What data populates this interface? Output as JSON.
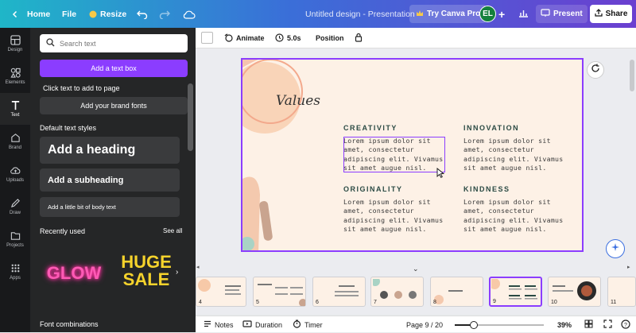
{
  "topbar": {
    "home_label": "Home",
    "file_label": "File",
    "resize_label": "Resize",
    "doc_title": "Untitled design - Presentation",
    "try_label": "Try Canva Pro",
    "avatar_initials": "EL",
    "present_label": "Present",
    "share_label": "Share"
  },
  "rail": {
    "items": [
      {
        "label": "Design"
      },
      {
        "label": "Elements"
      },
      {
        "label": "Text"
      },
      {
        "label": "Brand"
      },
      {
        "label": "Uploads"
      },
      {
        "label": "Draw"
      },
      {
        "label": "Projects"
      },
      {
        "label": "Apps"
      }
    ]
  },
  "panel": {
    "search_placeholder": "Search text",
    "add_text_box": "Add a text box",
    "click_hint": "Click text to add to page",
    "brand_fonts": "Add your brand fonts",
    "default_styles": "Default text styles",
    "heading": "Add a heading",
    "subheading": "Add a subheading",
    "body": "Add a little bit of body text",
    "recently_used": "Recently used",
    "see_all": "See all",
    "recent1": "GLOW",
    "recent2_line1": "HUGE",
    "recent2_line2": "SALE",
    "font_combinations": "Font combinations"
  },
  "toolbar": {
    "animate": "Animate",
    "duration": "5.0s",
    "position": "Position"
  },
  "slide": {
    "title": "Values",
    "sections": [
      {
        "heading": "CREATIVITY",
        "lines": [
          "Lorem ipsum dolor sit",
          "amet, consectetur",
          "adipiscing elit. Vivamus",
          "sit amet augue nisl."
        ]
      },
      {
        "heading": "INNOVATION",
        "lines": [
          "Lorem ipsum dolor sit",
          "amet, consectetur",
          "adipiscing elit. Vivamus",
          "sit amet augue nisl."
        ]
      },
      {
        "heading": "ORIGINALITY",
        "lines": [
          "Lorem ipsum dolor sit",
          "amet, consectetur",
          "adipiscing elit. Vivamus",
          "sit amet augue nisl."
        ]
      },
      {
        "heading": "KINDNESS",
        "lines": [
          "Lorem ipsum dolor sit",
          "amet, consectetur",
          "adipiscing elit. Vivamus",
          "sit amet augue nisl."
        ]
      }
    ]
  },
  "thumbnails": [
    {
      "num": "4"
    },
    {
      "num": "5"
    },
    {
      "num": "6"
    },
    {
      "num": "7"
    },
    {
      "num": "8"
    },
    {
      "num": "9"
    },
    {
      "num": "10"
    },
    {
      "num": "11"
    }
  ],
  "bottombar": {
    "notes": "Notes",
    "duration": "Duration",
    "timer": "Timer",
    "page": "Page 9 / 20",
    "zoom": "39%",
    "zoom_level": 0.39
  },
  "colors": {
    "accent": "#8b3dff",
    "slide_bg": "#fdf1e6",
    "heading": "#2b4a44"
  }
}
